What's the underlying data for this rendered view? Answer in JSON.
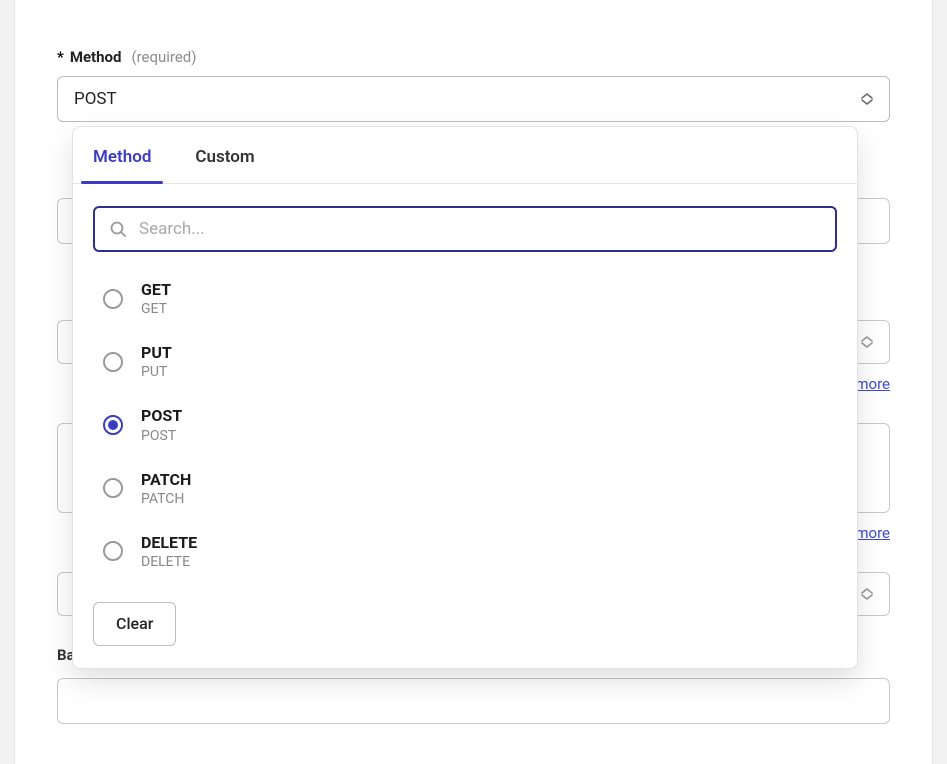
{
  "field": {
    "asterisk": "*",
    "label": "Method",
    "hint": "(required)",
    "value": "POST"
  },
  "more": "more",
  "basicAuth": "Basic Auth",
  "dropdown": {
    "tabs": {
      "method": "Method",
      "custom": "Custom"
    },
    "searchPlaceholder": "Search...",
    "options": {
      "o0": {
        "title": "GET",
        "sub": "GET"
      },
      "o1": {
        "title": "PUT",
        "sub": "PUT"
      },
      "o2": {
        "title": "POST",
        "sub": "POST"
      },
      "o3": {
        "title": "PATCH",
        "sub": "PATCH"
      },
      "o4": {
        "title": "DELETE",
        "sub": "DELETE"
      }
    },
    "clear": "Clear"
  }
}
